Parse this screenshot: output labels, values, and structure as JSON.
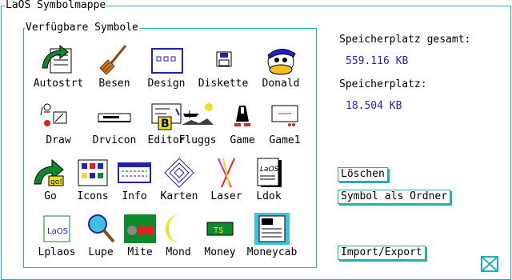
{
  "window": {
    "title": "LaOS Symbolmappe"
  },
  "panel": {
    "title": "Verfügbare Symbole"
  },
  "icons": [
    {
      "label": "Autostrt",
      "icon": "autostart-icon"
    },
    {
      "label": "Besen",
      "icon": "broom-icon"
    },
    {
      "label": "Design",
      "icon": "design-icon"
    },
    {
      "label": "Diskette",
      "icon": "floppy-disk-icon"
    },
    {
      "label": "Donald",
      "icon": "donald-duck-icon"
    },
    {
      "label": "Draw",
      "icon": "draw-icon"
    },
    {
      "label": "Drvicon",
      "icon": "drive-icon"
    },
    {
      "label": "Editor",
      "icon": "editor-icon"
    },
    {
      "label": "Fluggs",
      "icon": "airplane-icon"
    },
    {
      "label": "Game",
      "icon": "game-figure-icon"
    },
    {
      "label": "Game1",
      "icon": "game-screen-icon"
    },
    {
      "label": "Go",
      "icon": "go-arrow-icon"
    },
    {
      "label": "Icons",
      "icon": "icons-grid-icon"
    },
    {
      "label": "Info",
      "icon": "info-window-icon"
    },
    {
      "label": "Karten",
      "icon": "diamond-card-icon"
    },
    {
      "label": "Laser",
      "icon": "laser-icon"
    },
    {
      "label": "Ldok",
      "icon": "laos-document-icon"
    },
    {
      "label": "Lplaos",
      "icon": "lplaos-icon"
    },
    {
      "label": "Lupe",
      "icon": "magnifier-icon"
    },
    {
      "label": "Mite",
      "icon": "mite-icon"
    },
    {
      "label": "Mond",
      "icon": "moon-icon"
    },
    {
      "label": "Money",
      "icon": "money-icon"
    },
    {
      "label": "Moneycab",
      "icon": "moneycab-icon"
    }
  ],
  "storage": {
    "total_label": "Speicherplatz gesamt:",
    "total_value": "559.116 KB",
    "free_label": "Speicherplatz:",
    "free_value": "18.504 KB"
  },
  "buttons": {
    "delete": "Löschen",
    "as_folder": "Symbol als Ordner",
    "import_export": "Import/Export"
  },
  "colors": {
    "frame": "#20b0b0",
    "value_text": "#2222cc"
  }
}
